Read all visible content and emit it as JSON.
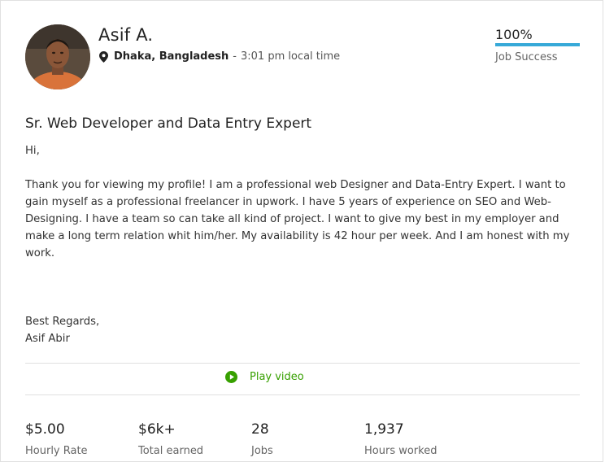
{
  "profile": {
    "name": "Asif A.",
    "location": "Dhaka, Bangladesh",
    "separator": "-",
    "local_time": "3:01 pm local time",
    "job_success": {
      "value": "100%",
      "label": "Job Success",
      "fraction": 1.0
    }
  },
  "title": "Sr. Web Developer and Data Entry Expert",
  "overview": {
    "greeting": "Hi,",
    "body": "Thank you for viewing my profile! I am a professional web Designer and Data-Entry Expert. I want to gain myself as a professional freelancer in upwork. I have 5 years of experience on SEO and Web-Designing. I have a team so can take all kind of project. I want to give my best in my employer and make a long term relation whit him/her. My availability is 42 hour per week. And I am honest with my work.",
    "closing": "Best Regards,",
    "signature": "Asif Abir"
  },
  "video": {
    "label": "Play video",
    "icon": "play-circle-icon"
  },
  "stats": [
    {
      "value": "$5.00",
      "label": "Hourly Rate"
    },
    {
      "value": "$6k+",
      "label": "Total earned"
    },
    {
      "value": "28",
      "label": "Jobs"
    },
    {
      "value": "1,937",
      "label": "Hours worked"
    }
  ],
  "colors": {
    "accent_blue": "#37a9d8",
    "accent_green": "#37a000",
    "muted_text": "#656565",
    "divider": "#e0e0e0"
  }
}
